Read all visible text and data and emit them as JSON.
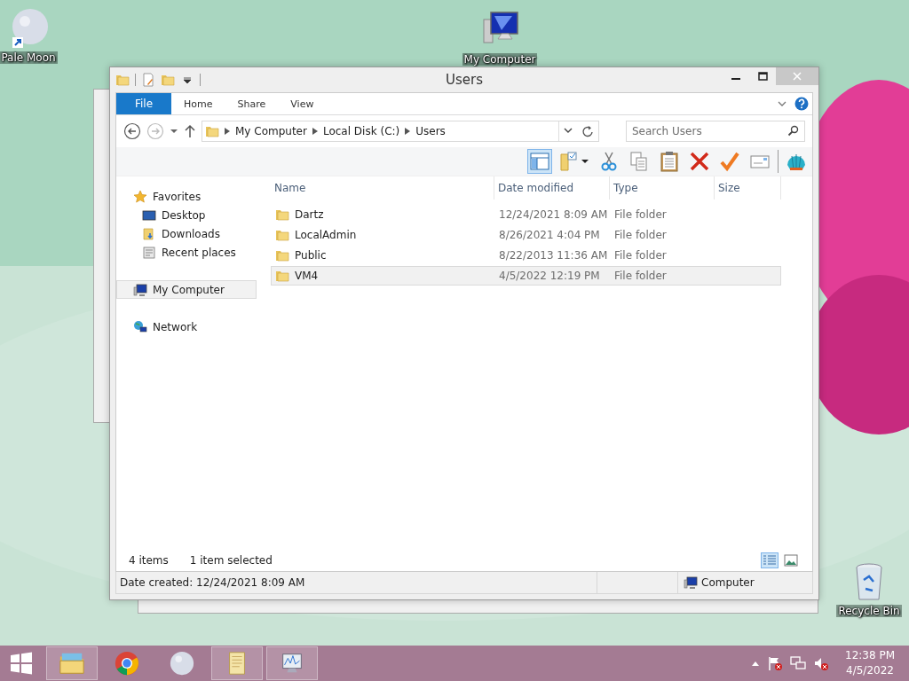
{
  "desktop_icons": [
    {
      "label": "Pale Moon",
      "kind": "moon"
    },
    {
      "label": "My Computer",
      "kind": "computer"
    },
    {
      "label": "Recycle Bin",
      "kind": "bin"
    }
  ],
  "window": {
    "title": "Users"
  },
  "ribbon_tabs": [
    {
      "label": "File",
      "kind": "file"
    },
    {
      "label": "Home",
      "kind": "tab"
    },
    {
      "label": "Share",
      "kind": "tab"
    },
    {
      "label": "View",
      "kind": "tab"
    }
  ],
  "address": {
    "breadcrumbs": [
      "My Computer",
      "Local Disk (C:)",
      "Users"
    ]
  },
  "search": {
    "placeholder": "Search Users"
  },
  "navigation": [
    {
      "label": "Favorites",
      "kind": "star",
      "selected": false,
      "children": [
        {
          "label": "Desktop",
          "kind": "desktop",
          "selected": false
        },
        {
          "label": "Downloads",
          "kind": "downloads",
          "selected": false
        },
        {
          "label": "Recent places",
          "kind": "recent",
          "selected": false
        }
      ]
    },
    {
      "label": "My Computer",
      "kind": "computer",
      "selected": true
    },
    {
      "label": "Network",
      "kind": "network",
      "selected": false
    }
  ],
  "columns": [
    "Name",
    "Date modified",
    "Type",
    "Size"
  ],
  "rows": [
    {
      "name": "Dartz",
      "date": "12/24/2021 8:09 AM",
      "type": "File folder",
      "selected": false
    },
    {
      "name": "LocalAdmin",
      "date": "8/26/2021 4:04 PM",
      "type": "File folder",
      "selected": false
    },
    {
      "name": "Public",
      "date": "8/22/2013 11:36 AM",
      "type": "File folder",
      "selected": false
    },
    {
      "name": "VM4",
      "date": "4/5/2022 12:19 PM",
      "type": "File folder",
      "selected": true
    }
  ],
  "item_count": "4 items",
  "selection": "1 item selected",
  "views": [
    {
      "kind": "details",
      "selected": true
    },
    {
      "kind": "thumbnails",
      "selected": false
    }
  ],
  "status_bar": {
    "details": "Date created: 12/24/2021 8:09 AM",
    "location": "Computer"
  },
  "taskbar": {
    "apps": [
      {
        "kind": "explorer",
        "running": true
      },
      {
        "kind": "chrome",
        "running": false
      },
      {
        "kind": "moon",
        "running": false
      },
      {
        "kind": "notepad",
        "running": true
      },
      {
        "kind": "monitor",
        "running": true
      }
    ],
    "time": "12:38 PM",
    "date": "4/5/2022"
  }
}
